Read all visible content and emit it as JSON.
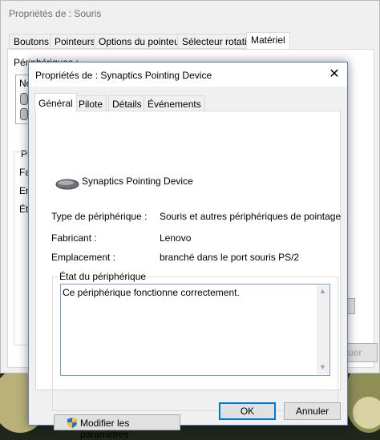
{
  "back_window": {
    "title": "Propriétés de : Souris",
    "tabs": [
      "Boutons",
      "Pointeurs",
      "Options du pointeur",
      "Sélecteur rotatif",
      "Matériel"
    ],
    "active_tab": 4,
    "fragments": {
      "devices_label": "Périphériques :",
      "no": "No",
      "pr": "Pr",
      "fa": "Fa",
      "em": "Em",
      "et": "Ét",
      "uer": "uer"
    }
  },
  "dialog": {
    "title": "Propriétés de : Synaptics Pointing Device",
    "close_glyph": "✕",
    "tabs": [
      "Général",
      "Pilote",
      "Détails",
      "Événements"
    ],
    "active_tab": 0,
    "device_name": "Synaptics Pointing Device",
    "rows": [
      {
        "label": "Type de périphérique :",
        "value": "Souris et autres périphériques de pointage"
      },
      {
        "label": "Fabricant :",
        "value": "Lenovo"
      },
      {
        "label": "Emplacement :",
        "value": "branché dans le port souris PS/2"
      }
    ],
    "status_group_label": "État du périphérique",
    "status_text": "Ce périphérique fonctionne correctement.",
    "modify_button": "Modifier les paramètres",
    "ok_button": "OK",
    "cancel_button": "Annuler"
  },
  "colors": {
    "focus_border": "#0078d7",
    "window_bg": "#f0f0f0"
  },
  "icons": {
    "device": "mouse-device-icon",
    "shield": "uac-shield-icon",
    "close": "close-icon"
  }
}
